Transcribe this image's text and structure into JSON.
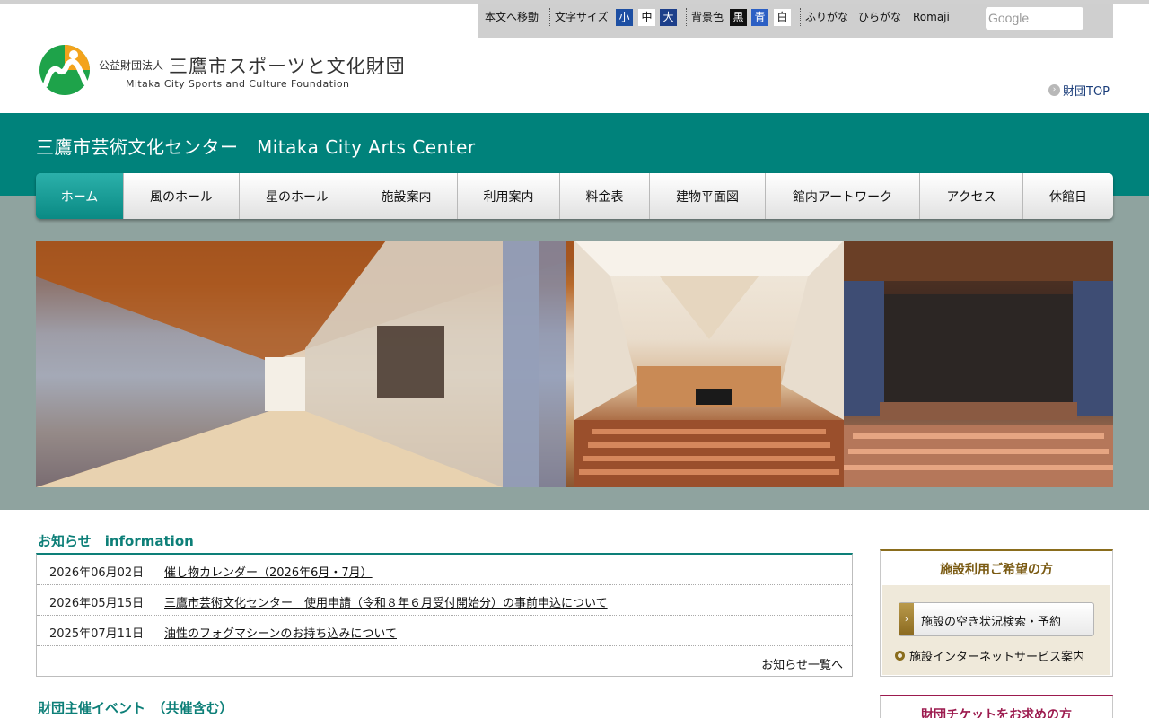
{
  "utility": {
    "skip": "本文へ移動",
    "fontsize_label": "文字サイズ",
    "fontsize_small": "小",
    "fontsize_mid": "中",
    "fontsize_large": "大",
    "bg_label": "背景色",
    "bg_black": "黒",
    "bg_blue": "青",
    "bg_white": "白",
    "furigana": "ふりがな",
    "hiragana": "ひらがな",
    "romaji": "Romaji",
    "search_placeholder": "Google"
  },
  "logo": {
    "small": "公益財団法人",
    "big": "三鷹市スポーツと文化財団",
    "en": "Mitaka City Sports and Culture Foundation"
  },
  "top_link": "財団TOP",
  "site_title": "三鷹市芸術文化センター　Mitaka City Arts Center",
  "nav": [
    "ホーム",
    "風のホール",
    "星のホール",
    "施設案内",
    "利用案内",
    "料金表",
    "建物平面図",
    "館内アートワーク",
    "アクセス",
    "休館日"
  ],
  "info": {
    "title": "お知らせ　information",
    "items": [
      {
        "date": "2026年06月02日",
        "text": "催し物カレンダー（2026年6月・7月）"
      },
      {
        "date": "2026年05月15日",
        "text": "三鷹市芸術文化センター　使用申請（令和８年６月受付開始分）の事前申込について"
      },
      {
        "date": "2025年07月11日",
        "text": "油性のフォグマシーンのお持ち込みについて"
      }
    ],
    "more": "お知らせ一覧へ"
  },
  "events_title": "財団主催イベント　（共催含む）",
  "side1": {
    "title": "施設利用ご希望の方",
    "button": "施設の空き状況検索・予約",
    "link": "施設インターネットサービス案内"
  },
  "side2": {
    "title": "財団チケットをお求めの方"
  },
  "colors": {
    "teal": "#00827b",
    "gold": "#8a6d1d",
    "crimson": "#9c1a4e"
  }
}
